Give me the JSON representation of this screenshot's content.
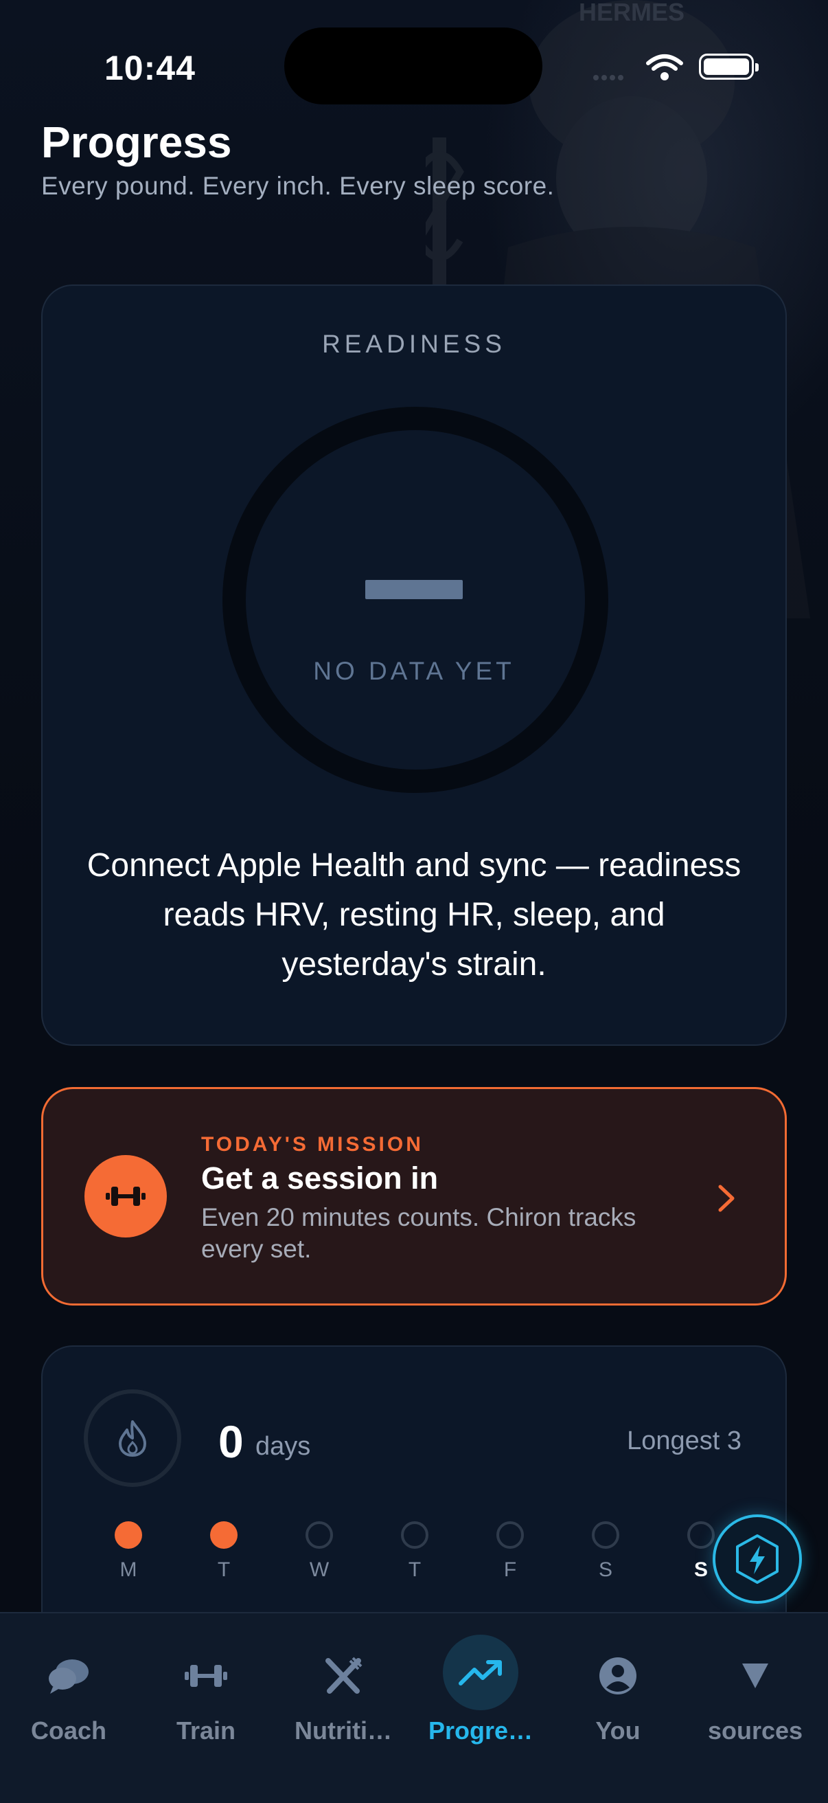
{
  "status_bar": {
    "time": "10:44"
  },
  "header": {
    "title": "Progress",
    "subtitle": "Every pound. Every inch. Every sleep score."
  },
  "background": {
    "figure_text": "HERMES"
  },
  "readiness": {
    "label": "READINESS",
    "value": "—",
    "caption": "NO DATA YET",
    "message": "Connect Apple Health and sync — readiness reads HRV, resting HR, sleep, and yesterday's strain."
  },
  "mission": {
    "eyebrow": "TODAY'S MISSION",
    "title": "Get a session in",
    "description": "Even 20 minutes counts. Chiron tracks every set.",
    "icon": "dumbbell-icon"
  },
  "streak": {
    "count": "0",
    "unit": "days",
    "longest": "Longest 3",
    "icon": "flame-icon",
    "days": [
      {
        "label": "M",
        "done": true
      },
      {
        "label": "T",
        "done": true
      },
      {
        "label": "W",
        "done": false
      },
      {
        "label": "T",
        "done": false
      },
      {
        "label": "F",
        "done": false
      },
      {
        "label": "S",
        "done": false
      },
      {
        "label": "S",
        "done": false,
        "today": true
      }
    ]
  },
  "fab": {
    "icon": "lightning-icon"
  },
  "tabs": [
    {
      "label": "Coach",
      "icon": "chat-icon",
      "active": false
    },
    {
      "label": "Train",
      "icon": "dumbbell-icon",
      "active": false
    },
    {
      "label": "Nutriti…",
      "icon": "fork-knife-icon",
      "active": false
    },
    {
      "label": "Progre…",
      "icon": "trending-up-icon",
      "active": true
    },
    {
      "label": "You",
      "icon": "person-icon",
      "active": false
    },
    {
      "label": "sources",
      "icon": "triangle-down-icon",
      "active": false
    }
  ],
  "colors": {
    "background": "#070c15",
    "card": "#0c1728",
    "accent_orange": "#f56b35",
    "accent_cyan": "#26b7ec",
    "muted_text": "#7b8799"
  }
}
